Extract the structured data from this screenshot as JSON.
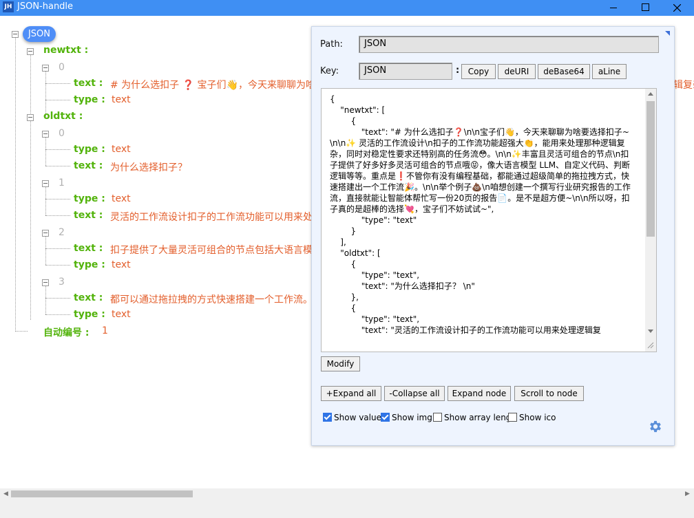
{
  "window": {
    "title": "JSON-handle",
    "app_icon": "JH",
    "minimize": "minimize-icon",
    "maximize": "maximize-icon",
    "close": "close-icon"
  },
  "tree": {
    "root": "JSON",
    "newtxt_key": "newtxt :",
    "newtxt_idx0": "0",
    "n0_text_key": "text :",
    "n0_text_val": "# 为什么选扣子 ❓ 宝子们👋，今天来聊聊为啥",
    "n0_text_tail": "辑复杂",
    "n0_type_key": "type :",
    "n0_type_val": "text",
    "oldtxt_key": "oldtxt :",
    "o0_idx": "0",
    "o0_type_key": "type :",
    "o0_type_val": "text",
    "o0_text_key": "text :",
    "o0_text_val": "为什么选择扣子？",
    "o1_idx": "1",
    "o1_type_key": "type :",
    "o1_type_val": "text",
    "o1_text_key": "text :",
    "o1_text_val": "灵活的工作流设计扣子的工作流功能可以用来处",
    "o2_idx": "2",
    "o2_text_key": "text :",
    "o2_text_val": "扣子提供了大量灵活可组合的节点包括大语言模",
    "o2_type_key": "type :",
    "o2_type_val": "text",
    "o3_idx": "3",
    "o3_text_key": "text :",
    "o3_text_val": "都可以通过拖拉拽的方式快速搭建一个工作流。",
    "o3_type_key": "type :",
    "o3_type_val": "text",
    "auto_key": "自动编号 :",
    "auto_val": "1"
  },
  "panel": {
    "path_label": "Path:",
    "path_value": "JSON",
    "key_label": "Key:",
    "key_value": "JSON",
    "colon": ":",
    "copy": "Copy",
    "deuri": "deURI",
    "debase64": "deBase64",
    "aline": "aLine",
    "editor_text": "{\n    \"newtxt\": [\n        {\n            \"text\": \"# 为什么选扣子❓\\n\\n宝子们👋，今天来聊聊为啥要选择扣子~\\n\\n✨ 灵活的工作流设计\\n扣子的工作流功能超强大👏，能用来处理那种逻辑复杂，同时对稳定性要求还特别高的任务流😳。\\n\\n✨丰富且灵活可组合的节点\\n扣子提供了好多好多灵活可组合的节点哦😝，像大语言模型 LLM、自定义代码、判断逻辑等等。重点是❗不管你有没有编程基础，都能通过超级简单的拖拉拽方式，快速搭建出一个工作流🎉。\\n\\n举个例子💩\\n咱想创建一个撰写行业研究报告的工作流，直接就能让智能体帮忙写一份20页的报告📄。是不是超方便~\\n\\n所以呀，扣子真的是超棒的选择💘，宝子们不妨试试~\",\n            \"type\": \"text\"\n        }\n    ],\n    \"oldtxt\": [\n        {\n            \"type\": \"text\",\n            \"text\": \"为什么选择扣子？ \\n\"\n        },\n        {\n            \"type\": \"text\",\n            \"text\": \"灵活的工作流设计扣子的工作流功能可以用来处理逻辑复",
    "modify": "Modify",
    "expand_all": "+Expand all",
    "collapse_all": "-Collapse all",
    "expand_node": "Expand node",
    "scroll_to_node": "Scroll to node",
    "show_value": "Show value",
    "show_value_checked": true,
    "show_img": "Show img",
    "show_img_checked": true,
    "show_array_leng": "Show array leng",
    "show_array_leng_checked": false,
    "show_ico": "Show ico",
    "show_ico_checked": false,
    "settings_icon": "gear-icon"
  },
  "colors": {
    "titlebar": "#3f8ff3",
    "key": "#52b30b",
    "value": "#e35e2b",
    "index": "#b0b0b0",
    "root_badge": "#4f8ef7",
    "panel_bg": "#eef4fe"
  }
}
